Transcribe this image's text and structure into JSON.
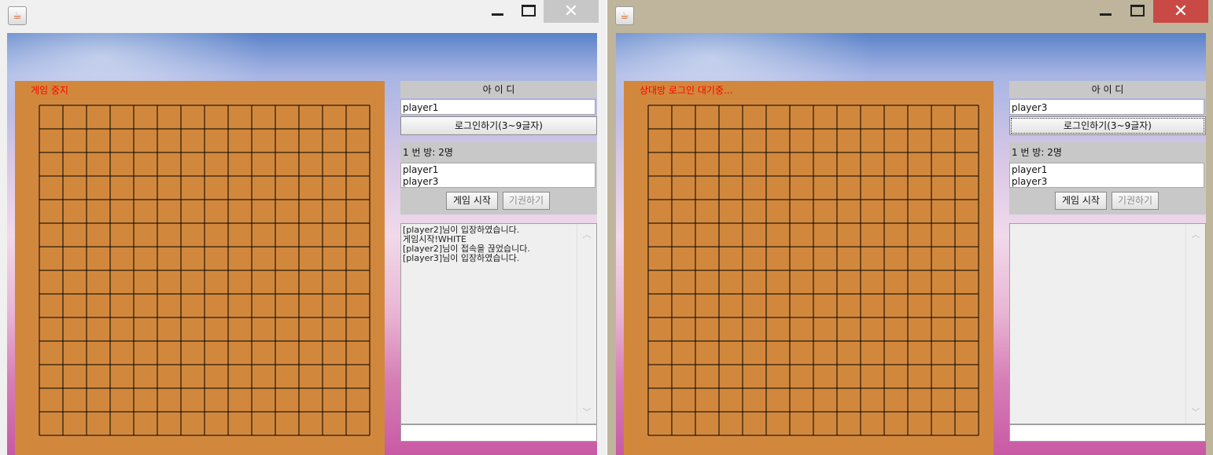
{
  "windows": [
    {
      "id": "client-1",
      "close_glyph": "✕",
      "status": "게임 중지",
      "id_label": "아 이 디",
      "id_value": "player1",
      "login_button": "로그인하기(3~9글자)",
      "room_label": "1 번 방: 2명",
      "users": [
        "player1",
        "player3"
      ],
      "start_button": "게임 시작",
      "surrender_button": "기권하기",
      "chat_log": [
        "[player2]님이 입장하였습니다.",
        "게임시작!WHITE",
        "[player2]님이 접속을 끊었습니다.",
        "[player3]님이 입장하였습니다."
      ],
      "chat_input": ""
    },
    {
      "id": "client-2",
      "close_glyph": "✕",
      "status": "상대방 로그인 대기중...",
      "id_label": "아 이 디",
      "id_value": "player3",
      "login_button": "로그인하기(3~9글자)",
      "room_label": "1 번 방: 2명",
      "users": [
        "player1",
        "player3"
      ],
      "start_button": "게임 시작",
      "surrender_button": "기권하기",
      "chat_log": [],
      "chat_input": ""
    }
  ],
  "icons": {
    "app_icon": "java-cup-icon",
    "minimize": "minimize-icon",
    "maximize": "maximize-icon",
    "close": "close-icon",
    "scroll_up": "chevron-up-icon",
    "scroll_down": "chevron-down-icon"
  },
  "board": {
    "cells": 14,
    "line_color": "#000000",
    "board_color": "#d2883c"
  },
  "colors": {
    "status_text": "#ff0000",
    "close_active": "#c94a44",
    "close_inactive": "#c7c7c7"
  }
}
